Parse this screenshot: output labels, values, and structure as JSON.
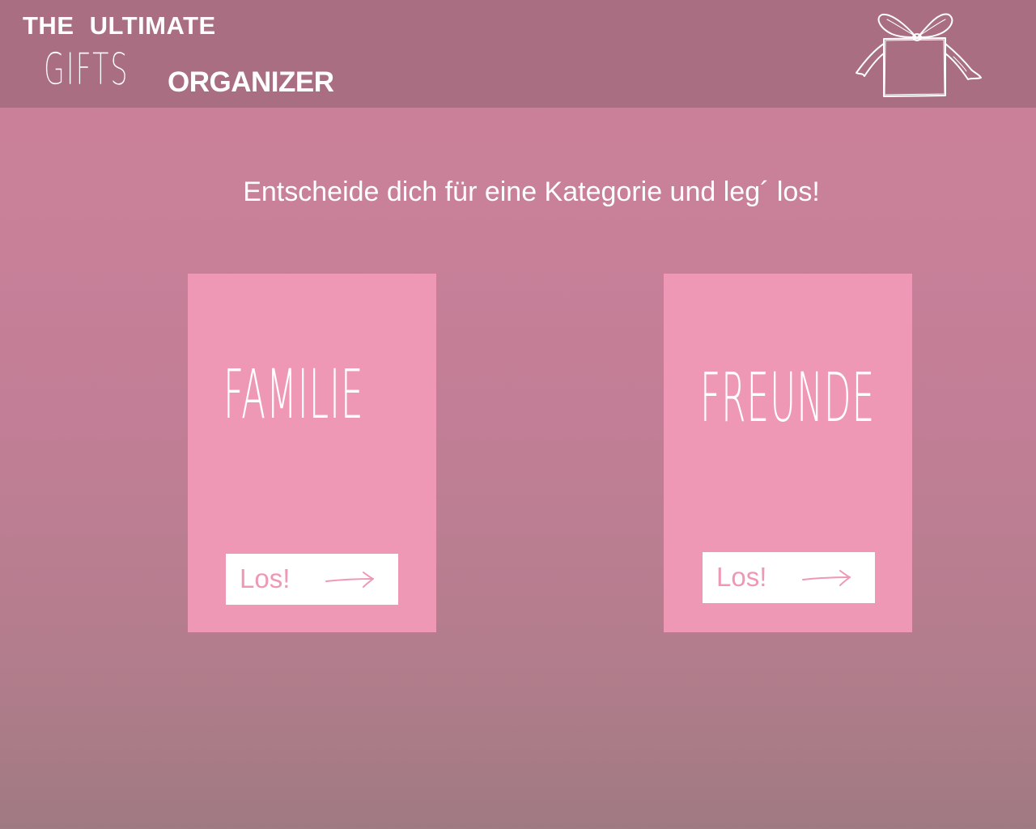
{
  "header": {
    "title_line1": "THE ULTIMATE",
    "title_gifts": "GIFTS",
    "title_organizer": "ORGANIZER",
    "logo_icon": "gift-box-icon"
  },
  "main": {
    "prompt": "Entscheide dich für eine Kategorie und leg´ los!"
  },
  "categories": [
    {
      "title": "FAMILIE",
      "button_label": "Los!",
      "button_icon": "arrow-right-icon"
    },
    {
      "title": "FREUNDE",
      "button_label": "Los!",
      "button_icon": "arrow-right-icon"
    }
  ],
  "colors": {
    "header_bg": "#a96e81",
    "page_bg": "#c98099",
    "card_bg": "#ee98b5",
    "button_bg": "#ffffff",
    "text": "#ffffff"
  }
}
